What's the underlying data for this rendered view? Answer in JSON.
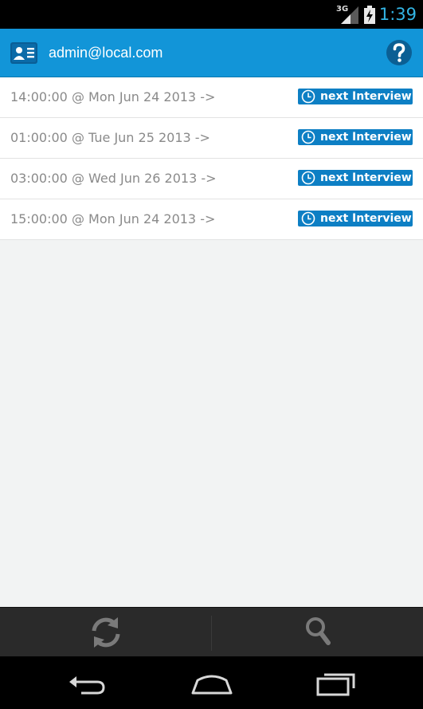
{
  "status_bar": {
    "network_label": "3G",
    "time": "1:39",
    "time_color": "#33b5e5",
    "icons": [
      "signal-icon",
      "battery-charging-icon"
    ]
  },
  "header": {
    "account": "admin@local.com",
    "background_color": "#1295d8",
    "icons": [
      "contact-card-icon",
      "help-icon"
    ]
  },
  "interviews": [
    {
      "datetime": "14:00:00 @ Mon Jun 24 2013 ->",
      "badge": "next Interview"
    },
    {
      "datetime": "01:00:00 @ Tue Jun 25 2013 ->",
      "badge": "next Interview"
    },
    {
      "datetime": "03:00:00 @ Wed Jun 26 2013 ->",
      "badge": "next Interview"
    },
    {
      "datetime": "15:00:00 @ Mon Jun 24 2013 ->",
      "badge": "next Interview"
    }
  ],
  "badge_color": "#0d7fc4",
  "toolbar": {
    "icons": [
      "refresh-icon",
      "search-icon"
    ]
  },
  "nav_bar": {
    "icons": [
      "back-icon",
      "home-icon",
      "recent-apps-icon"
    ]
  }
}
